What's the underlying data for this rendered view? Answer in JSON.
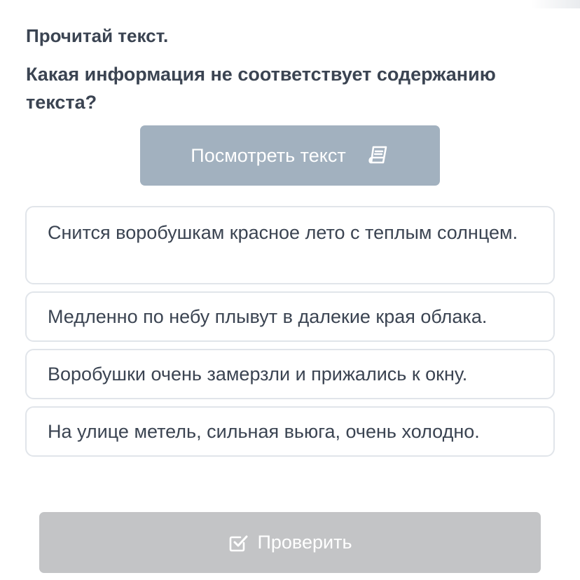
{
  "instruction": "Прочитай текст.",
  "question": "Какая информация не соответствует содержанию текста?",
  "view_text_button": {
    "label": "Посмотреть текст",
    "icon": "book-icon"
  },
  "options": [
    {
      "text": "Снится воробушкам красное лето с теплым солнцем."
    },
    {
      "text": "Медленно по небу плывут в далекие края облака."
    },
    {
      "text": "Воробушки очень замерзли и прижались к окну."
    },
    {
      "text": "На улице метель, сильная вьюга, очень холодно."
    }
  ],
  "check_button": {
    "label": "Проверить",
    "icon": "checkbox-check-icon",
    "enabled": false
  },
  "colors": {
    "text": "#3b4452",
    "view_button_bg": "#a2b1bf",
    "option_border": "#e1e5ea",
    "check_button_bg": "#c3c4c6"
  }
}
